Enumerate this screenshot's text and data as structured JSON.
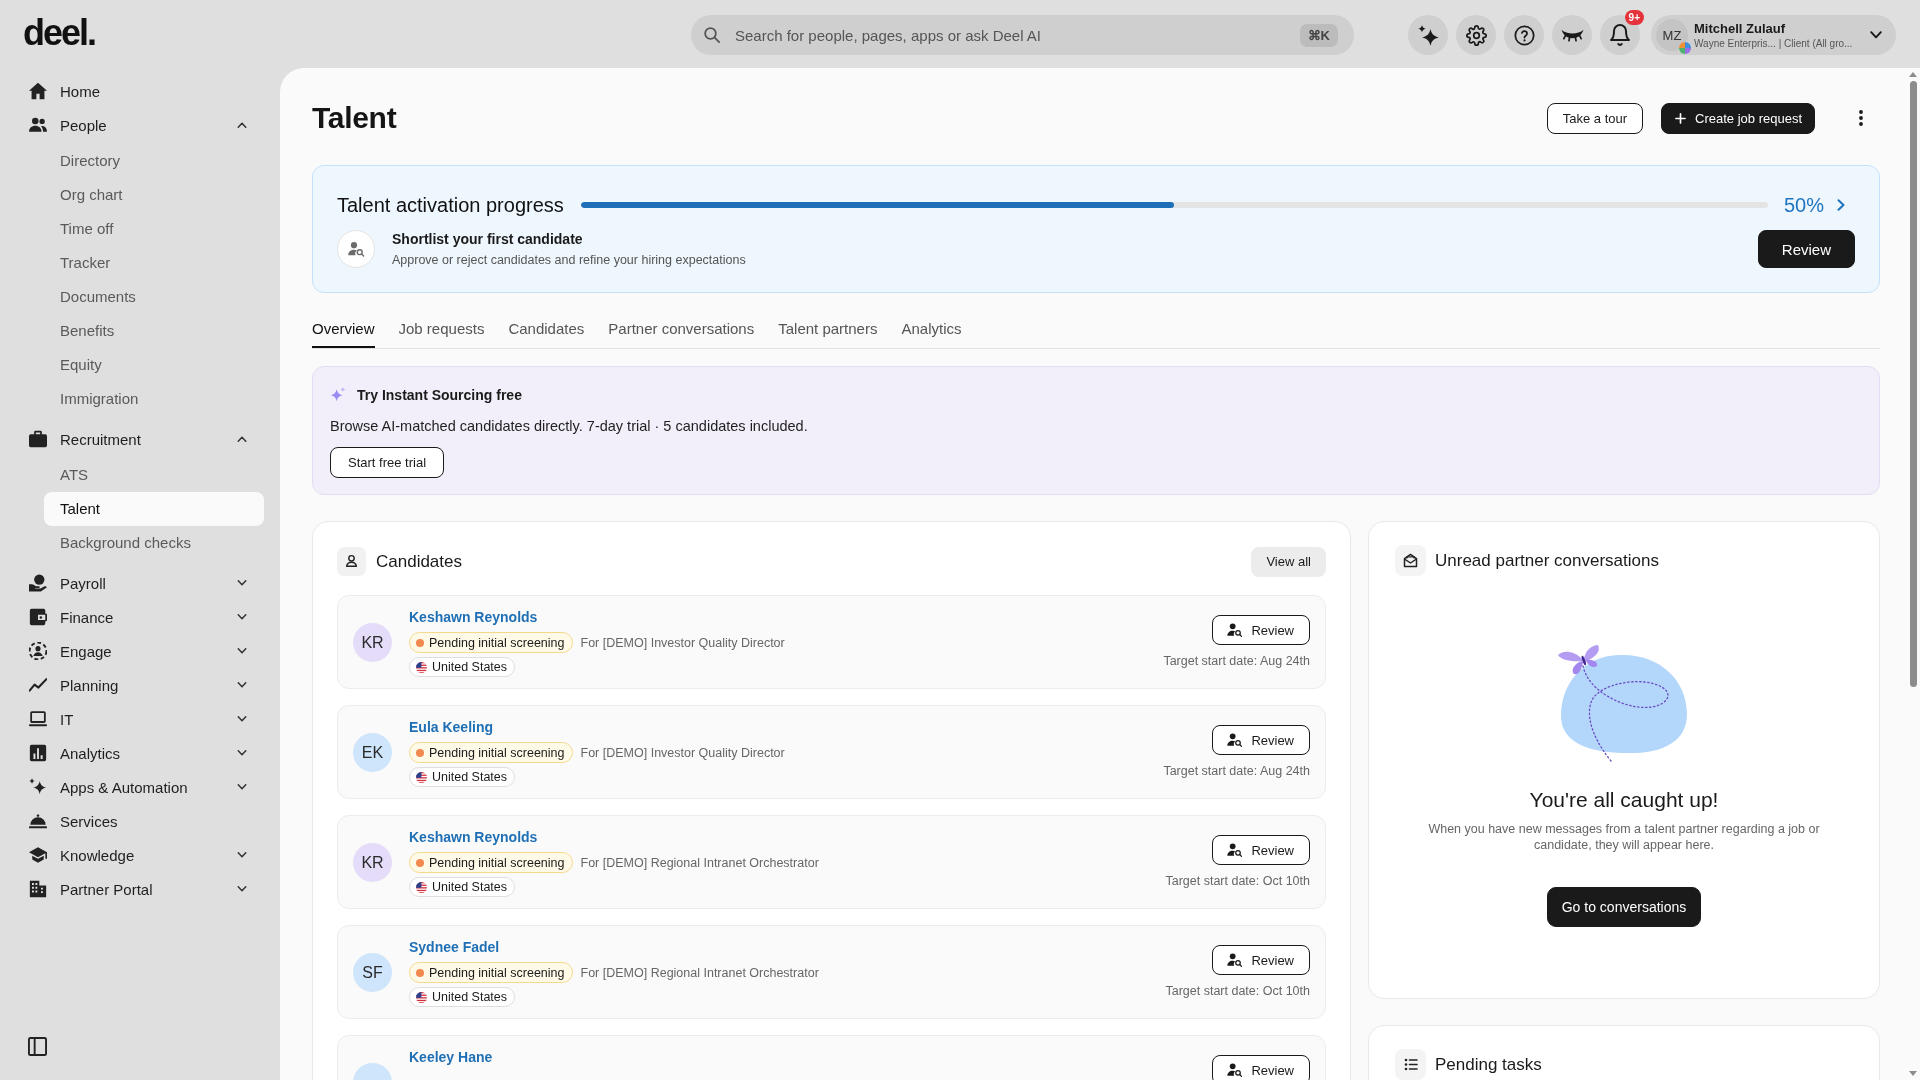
{
  "sidebar": {
    "logo": "deel.",
    "items": [
      {
        "label": "Home",
        "kind": "link"
      },
      {
        "label": "People",
        "kind": "group",
        "expanded": true,
        "children": [
          {
            "label": "Directory",
            "selected": false
          },
          {
            "label": "Org chart",
            "selected": false
          },
          {
            "label": "Time off",
            "selected": false
          },
          {
            "label": "Tracker",
            "selected": false
          },
          {
            "label": "Documents",
            "selected": false
          },
          {
            "label": "Benefits",
            "selected": false
          },
          {
            "label": "Equity",
            "selected": false
          },
          {
            "label": "Immigration",
            "selected": false
          }
        ]
      },
      {
        "label": "Recruitment",
        "kind": "group",
        "expanded": true,
        "children": [
          {
            "label": "ATS",
            "selected": false
          },
          {
            "label": "Talent",
            "selected": true
          },
          {
            "label": "Background checks",
            "selected": false
          }
        ]
      },
      {
        "label": "Payroll",
        "kind": "group",
        "expanded": false
      },
      {
        "label": "Finance",
        "kind": "group",
        "expanded": false
      },
      {
        "label": "Engage",
        "kind": "group",
        "expanded": false
      },
      {
        "label": "Planning",
        "kind": "group",
        "expanded": false
      },
      {
        "label": "IT",
        "kind": "group",
        "expanded": false
      },
      {
        "label": "Analytics",
        "kind": "group",
        "expanded": false
      },
      {
        "label": "Apps & Automation",
        "kind": "group",
        "expanded": false
      },
      {
        "label": "Services",
        "kind": "link"
      },
      {
        "label": "Knowledge",
        "kind": "group",
        "expanded": false
      },
      {
        "label": "Partner Portal",
        "kind": "group",
        "expanded": false
      }
    ]
  },
  "topbar": {
    "search": {
      "placeholder": "Search for people, pages, apps or ask Deel AI",
      "shortcut": "⌘K"
    },
    "notifications_badge": "9+",
    "profile": {
      "initials": "MZ",
      "name": "Mitchell Zulauf",
      "subtitle": "Wayne Enterpris... | Client (All gro..."
    }
  },
  "page": {
    "title": "Talent",
    "buttons": [
      {
        "label": "Take a tour",
        "kind": "outline"
      },
      {
        "label": "Create job request",
        "kind": "primary"
      }
    ]
  },
  "progress_card": {
    "title": "Talent activation progress",
    "level": 0.5,
    "percent": "50%",
    "step_title": "Shortlist your first candidate",
    "step_description": "Approve or reject candidates and refine your hiring expectations",
    "button": "Review"
  },
  "tabs": [
    {
      "label": "Overview",
      "selected": true
    },
    {
      "label": "Job requests",
      "selected": false
    },
    {
      "label": "Candidates",
      "selected": false
    },
    {
      "label": "Partner conversations",
      "selected": false
    },
    {
      "label": "Talent partners",
      "selected": false
    },
    {
      "label": "Analytics",
      "selected": false
    }
  ],
  "promo": {
    "title": "Try Instant Sourcing free",
    "text": "Browse AI-matched candidates directly. 7-day trial · 5 candidates included.",
    "button": "Start free trial"
  },
  "candidates_card": {
    "title": "Candidates",
    "view_all": "View all",
    "rows": [
      {
        "name": "Keshawn Reynolds",
        "initials": "KR",
        "color": "#e4dcf9",
        "status": "Pending initial screening",
        "role": "For [DEMO] Investor Quality Director",
        "country": "United States",
        "button": "Review",
        "start_date": "Target start date: Aug 24th"
      },
      {
        "name": "Eula Keeling",
        "initials": "EK",
        "color": "#cfe5fb",
        "status": "Pending initial screening",
        "role": "For [DEMO] Investor Quality Director",
        "country": "United States",
        "button": "Review",
        "start_date": "Target start date: Aug 24th"
      },
      {
        "name": "Keshawn Reynolds",
        "initials": "KR",
        "color": "#e4dcf9",
        "status": "Pending initial screening",
        "role": "For [DEMO] Regional Intranet Orchestrator",
        "country": "United States",
        "button": "Review",
        "start_date": "Target start date: Oct 10th"
      },
      {
        "name": "Sydnee Fadel",
        "initials": "SF",
        "color": "#cfe5fb",
        "status": "Pending initial screening",
        "role": "For [DEMO] Regional Intranet Orchestrator",
        "country": "United States",
        "button": "Review",
        "start_date": "Target start date: Oct 10th"
      },
      {
        "name": "Keeley Hane",
        "color": "#cfe5fb",
        "button": "Review"
      }
    ]
  },
  "conversations_card": {
    "title": "Unread partner conversations",
    "empty_title": "You're all caught up!",
    "empty_text": "When you have new messages from a talent partner regarding a job or candidate, they will appear here.",
    "button": "Go to conversations"
  },
  "tasks_card": {
    "title": "Pending tasks"
  }
}
